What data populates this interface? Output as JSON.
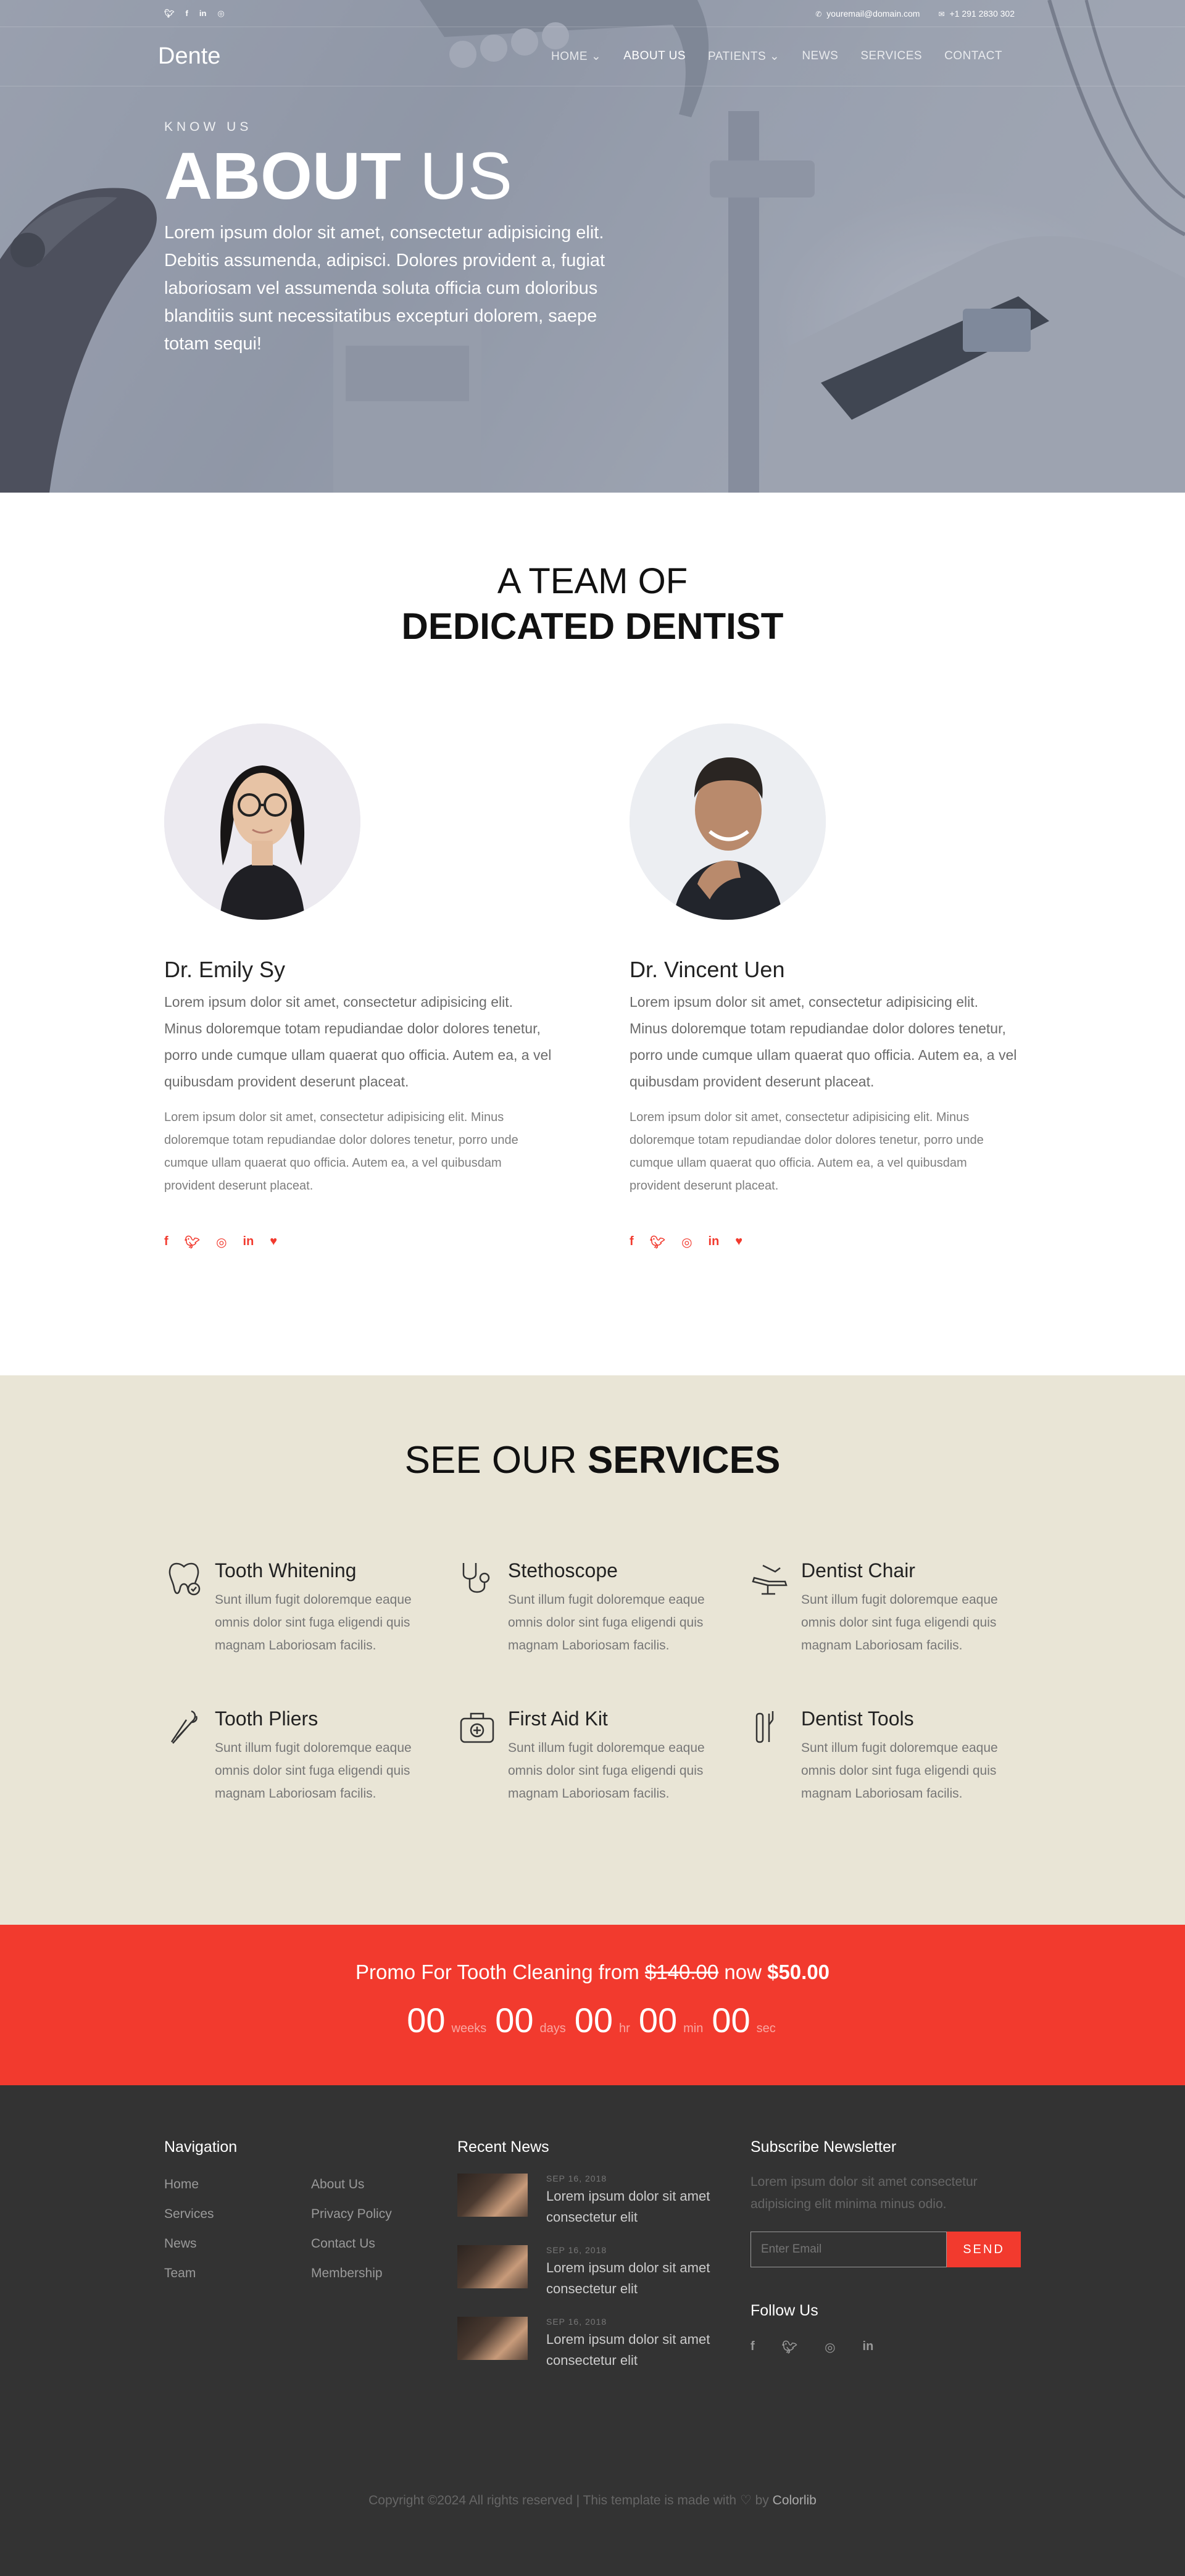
{
  "topbar": {
    "social_icons": [
      "twitter-icon",
      "facebook-icon",
      "linkedin-icon",
      "instagram-icon"
    ],
    "email": "youremail@domain.com",
    "phone": "+1 291 2830 302"
  },
  "nav": {
    "logo": "Dente",
    "items": [
      "HOME",
      "ABOUT US",
      "PATIENTS",
      "NEWS",
      "SERVICES",
      "CONTACT"
    ],
    "active": "ABOUT US"
  },
  "hero": {
    "kicker": "KNOW US",
    "title_bold": "ABOUT",
    "title_light": "US",
    "text": "Lorem ipsum dolor sit amet, consectetur adipisicing elit. Debitis assumenda, adipisci. Dolores provident a, fugiat laboriosam vel assumenda soluta officia cum doloribus blanditiis sunt necessitatibus excepturi dolorem, saepe totam sequi!"
  },
  "team": {
    "title_line1": "A TEAM OF",
    "title_line2": "DEDICATED DENTIST",
    "members": [
      {
        "name": "Dr. Emily Sy",
        "lead": "Lorem ipsum dolor sit amet, consectetur adipisicing elit. Minus doloremque totam repudiandae dolor dolores tenetur, porro unde cumque ullam quaerat quo officia. Autem ea, a vel quibusdam provident deserunt placeat.",
        "body": "Lorem ipsum dolor sit amet, consectetur adipisicing elit. Minus doloremque totam repudiandae dolor dolores tenetur, porro unde cumque ullam quaerat quo officia. Autem ea, a vel quibusdam provident deserunt placeat."
      },
      {
        "name": "Dr. Vincent Uen",
        "lead": "Lorem ipsum dolor sit amet, consectetur adipisicing elit. Minus doloremque totam repudiandae dolor dolores tenetur, porro unde cumque ullam quaerat quo officia. Autem ea, a vel quibusdam provident deserunt placeat.",
        "body": "Lorem ipsum dolor sit amet, consectetur adipisicing elit. Minus doloremque totam repudiandae dolor dolores tenetur, porro unde cumque ullam quaerat quo officia. Autem ea, a vel quibusdam provident deserunt placeat."
      }
    ],
    "member_social_icons": [
      "facebook-icon",
      "twitter-icon",
      "instagram-icon",
      "linkedin-icon",
      "heart-icon"
    ]
  },
  "services": {
    "title_light": "SEE OUR",
    "title_bold": "SERVICES",
    "items": [
      {
        "title": "Tooth Whitening",
        "icon": "tooth-icon",
        "desc": "Sunt illum fugit doloremque eaque omnis dolor sint fuga eligendi quis magnam Laboriosam facilis."
      },
      {
        "title": "Stethoscope",
        "icon": "stethoscope-icon",
        "desc": "Sunt illum fugit doloremque eaque omnis dolor sint fuga eligendi quis magnam Laboriosam facilis."
      },
      {
        "title": "Dentist Chair",
        "icon": "dentist-chair-icon",
        "desc": "Sunt illum fugit doloremque eaque omnis dolor sint fuga eligendi quis magnam Laboriosam facilis."
      },
      {
        "title": "Tooth Pliers",
        "icon": "tooth-pliers-icon",
        "desc": "Sunt illum fugit doloremque eaque omnis dolor sint fuga eligendi quis magnam Laboriosam facilis."
      },
      {
        "title": "First Aid Kit",
        "icon": "first-aid-kit-icon",
        "desc": "Sunt illum fugit doloremque eaque omnis dolor sint fuga eligendi quis magnam Laboriosam facilis."
      },
      {
        "title": "Dentist Tools",
        "icon": "dentist-tools-icon",
        "desc": "Sunt illum fugit doloremque eaque omnis dolor sint fuga eligendi quis magnam Laboriosam facilis."
      }
    ]
  },
  "promo": {
    "text_before": "Promo For Tooth Cleaning from",
    "old_price": "$140.00",
    "text_mid": "now",
    "new_price": "$50.00",
    "countdown": [
      {
        "value": "00",
        "label": "weeks"
      },
      {
        "value": "00",
        "label": "days"
      },
      {
        "value": "00",
        "label": "hr"
      },
      {
        "value": "00",
        "label": "min"
      },
      {
        "value": "00",
        "label": "sec"
      }
    ]
  },
  "footer": {
    "nav_heading": "Navigation",
    "nav_links": [
      "Home",
      "About Us",
      "Services",
      "Privacy Policy",
      "News",
      "Contact Us",
      "Team",
      "Membership"
    ],
    "news_heading": "Recent News",
    "news": [
      {
        "date": "SEP 16, 2018",
        "title": "Lorem ipsum dolor sit amet consectetur elit"
      },
      {
        "date": "SEP 16, 2018",
        "title": "Lorem ipsum dolor sit amet consectetur elit"
      },
      {
        "date": "SEP 16, 2018",
        "title": "Lorem ipsum dolor sit amet consectetur elit"
      }
    ],
    "newsletter_heading": "Subscribe Newsletter",
    "newsletter_text": "Lorem ipsum dolor sit amet consectetur adipisicing elit minima minus odio.",
    "email_placeholder": "Enter Email",
    "send_label": "SEND",
    "follow_heading": "Follow Us",
    "follow_icons": [
      "facebook-icon",
      "twitter-icon",
      "instagram-icon",
      "linkedin-icon"
    ],
    "copyright_pre": "Copyright ©2024 All rights reserved | This template is made with",
    "copyright_by": "by",
    "copyright_brand": "Colorlib"
  },
  "colors": {
    "accent": "#f23a2e",
    "services_bg": "#e9e5d6",
    "footer_bg": "#333333"
  }
}
